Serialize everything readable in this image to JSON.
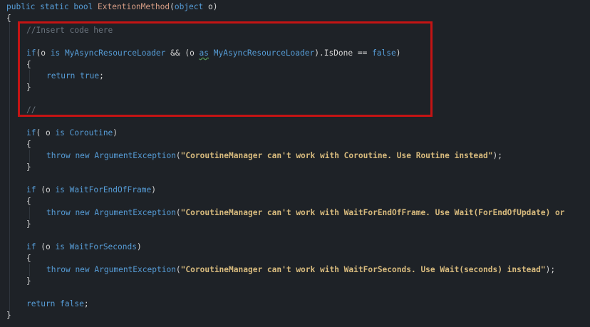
{
  "colors": {
    "background": "#1e2227",
    "keyword": "#569cd6",
    "type": "#4ec9b0",
    "method": "#dcdcaa",
    "string": "#d69d85",
    "comment": "#57a64a",
    "highlight_border": "#c41414"
  },
  "code": {
    "line01": {
      "kw1": "public",
      "kw2": "static",
      "kw3": "bool",
      "fn": "ExtentionMethod",
      "p1": "(",
      "kw4": "object",
      "rest": " o)"
    },
    "line02": {
      "t": "{"
    },
    "line03": {
      "cm": "//Insert code here"
    },
    "line05": {
      "kw1": "if",
      "p1": "(o ",
      "kw2": "is",
      "sp1": " ",
      "type1": "MyAsyncResourceLoader",
      "p2": " && (o ",
      "kw3": "as",
      "sp2": " ",
      "type2": "MyAsyncResourceLoader",
      "p3": ").IsDone == ",
      "kw4": "false",
      "p4": ")"
    },
    "line06": {
      "t": "{"
    },
    "line07": {
      "kw1": "return",
      "sp": " ",
      "kw2": "true",
      "p": ";"
    },
    "line08": {
      "t": "}"
    },
    "line10": {
      "cm": "//"
    },
    "line12": {
      "kw1": "if",
      "p1": "( o ",
      "kw2": "is",
      "sp": " ",
      "type": "Coroutine",
      "p2": ")"
    },
    "line13": {
      "t": "{"
    },
    "line14": {
      "kw1": "throw",
      "sp1": " ",
      "kw2": "new",
      "sp2": " ",
      "type": "ArgumentException",
      "p1": "(",
      "str": "\"CoroutineManager can't work with Coroutine. Use Routine instead\"",
      "p2": ");"
    },
    "line15": {
      "t": "}"
    },
    "line17": {
      "kw1": "if",
      "p1": " (o ",
      "kw2": "is",
      "sp": " ",
      "type": "WaitForEndOfFrame",
      "p2": ")"
    },
    "line18": {
      "t": "{"
    },
    "line19": {
      "kw1": "throw",
      "sp1": " ",
      "kw2": "new",
      "sp2": " ",
      "type": "ArgumentException",
      "p1": "(",
      "str": "\"CoroutineManager can't work with WaitForEndOfFrame. Use Wait(ForEndOfUpdate) or"
    },
    "line20": {
      "t": "}"
    },
    "line22": {
      "kw1": "if",
      "p1": " (o ",
      "kw2": "is",
      "sp": " ",
      "type": "WaitForSeconds",
      "p2": ")"
    },
    "line23": {
      "t": "{"
    },
    "line24": {
      "kw1": "throw",
      "sp1": " ",
      "kw2": "new",
      "sp2": " ",
      "type": "ArgumentException",
      "p1": "(",
      "str": "\"CoroutineManager can't work with WaitForSeconds. Use Wait(seconds) instead\"",
      "p2": ");"
    },
    "line25": {
      "t": "}"
    },
    "line27": {
      "kw1": "return",
      "sp": " ",
      "kw2": "false",
      "p": ";"
    },
    "line28": {
      "t": "}"
    }
  }
}
